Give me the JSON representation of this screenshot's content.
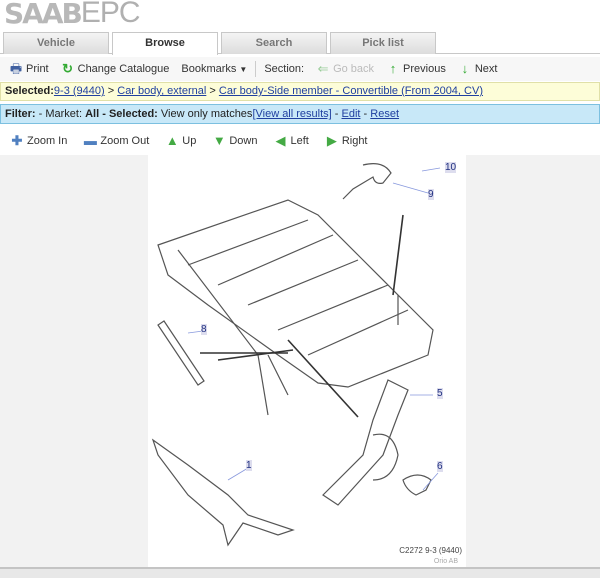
{
  "logo": {
    "brand": "SAAB",
    "product": "EPC"
  },
  "tabs": [
    "Vehicle",
    "Browse",
    "Search",
    "Pick list"
  ],
  "active_tab": "Browse",
  "toolbar": {
    "print": "Print",
    "change_catalogue": "Change Catalogue",
    "bookmarks": "Bookmarks",
    "section": "Section:",
    "go_back": "Go back",
    "previous": "Previous",
    "next": "Next"
  },
  "selected": {
    "label": "Selected:",
    "model": "9-3 (9440)",
    "sep": ">",
    "group": "Car body, external",
    "section": "Car body-Side member - Convertible (From 2004, CV)"
  },
  "filter": {
    "label": "Filter:",
    "market_prefix": "- Market:",
    "market": "All",
    "selected_prefix": "- Selected:",
    "selected": "View only matches",
    "view_all": "[View all results]",
    "dash": "-",
    "edit": "Edit",
    "reset": "Reset"
  },
  "nav": {
    "zoom_in": "Zoom In",
    "zoom_out": "Zoom Out",
    "up": "Up",
    "down": "Down",
    "left": "Left",
    "right": "Right"
  },
  "diagram": {
    "callouts": [
      "10",
      "9",
      "8",
      "5",
      "6",
      "1"
    ],
    "caption": "C2272 9-3 (9440)",
    "copyright": "Orio AB"
  }
}
